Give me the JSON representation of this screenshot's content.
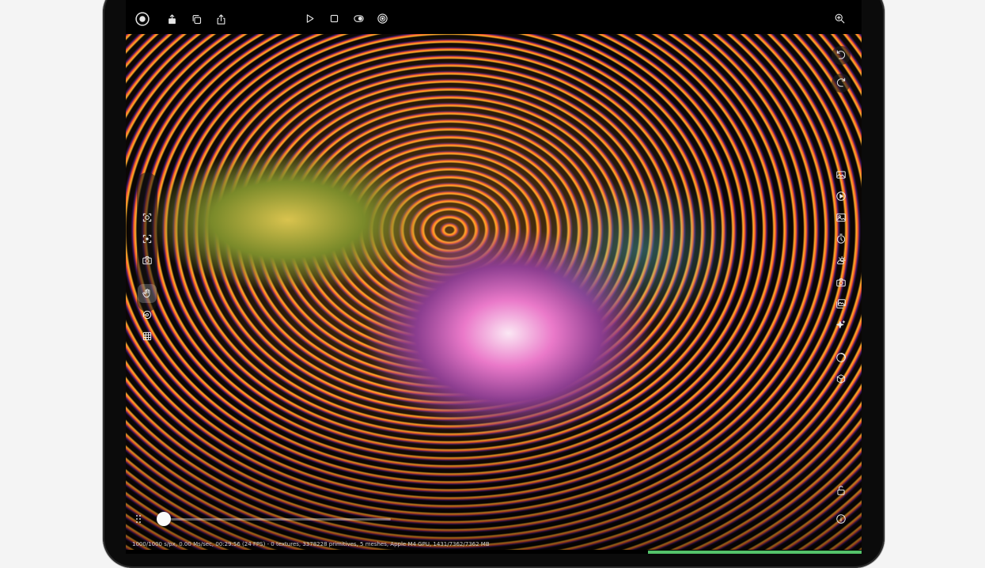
{
  "toolbar": {
    "left_icons": [
      "record-icon",
      "export-icon",
      "duplicate-icon",
      "share-icon"
    ],
    "center_icons": [
      "play-icon",
      "stop-icon",
      "toggle-view-icon",
      "target-icon"
    ],
    "right_icons": [
      "zoom-icon"
    ]
  },
  "left_panel": {
    "tools": [
      "frame-select-icon",
      "focus-icon",
      "camera-icon",
      "hand-icon",
      "orbit-icon",
      "checker-icon"
    ],
    "active_tool": "hand-icon"
  },
  "right_panel": {
    "top": [
      "undo-icon",
      "redo-icon"
    ],
    "tools": [
      "image-icon",
      "play-circle-icon",
      "picture-icon",
      "timer-icon",
      "weather-icon",
      "snapshot-icon",
      "gallery-icon",
      "sparkle-icon",
      "circle-icon",
      "cube-icon"
    ],
    "bottom": [
      "unlock-icon",
      "info-icon"
    ]
  },
  "timeline": {
    "progress": 0.0
  },
  "status": {
    "text": "1000/1000 s/px, 0.00 Ms/sec, 00:29:56 (24 FPS) - 0 textures, 3378228 primitives, 5 meshes, Apple M4 GPU, 1431/7362/7362 MB"
  },
  "colors": {
    "accent_green": "#54c26a",
    "screen_bg": "#000000"
  }
}
